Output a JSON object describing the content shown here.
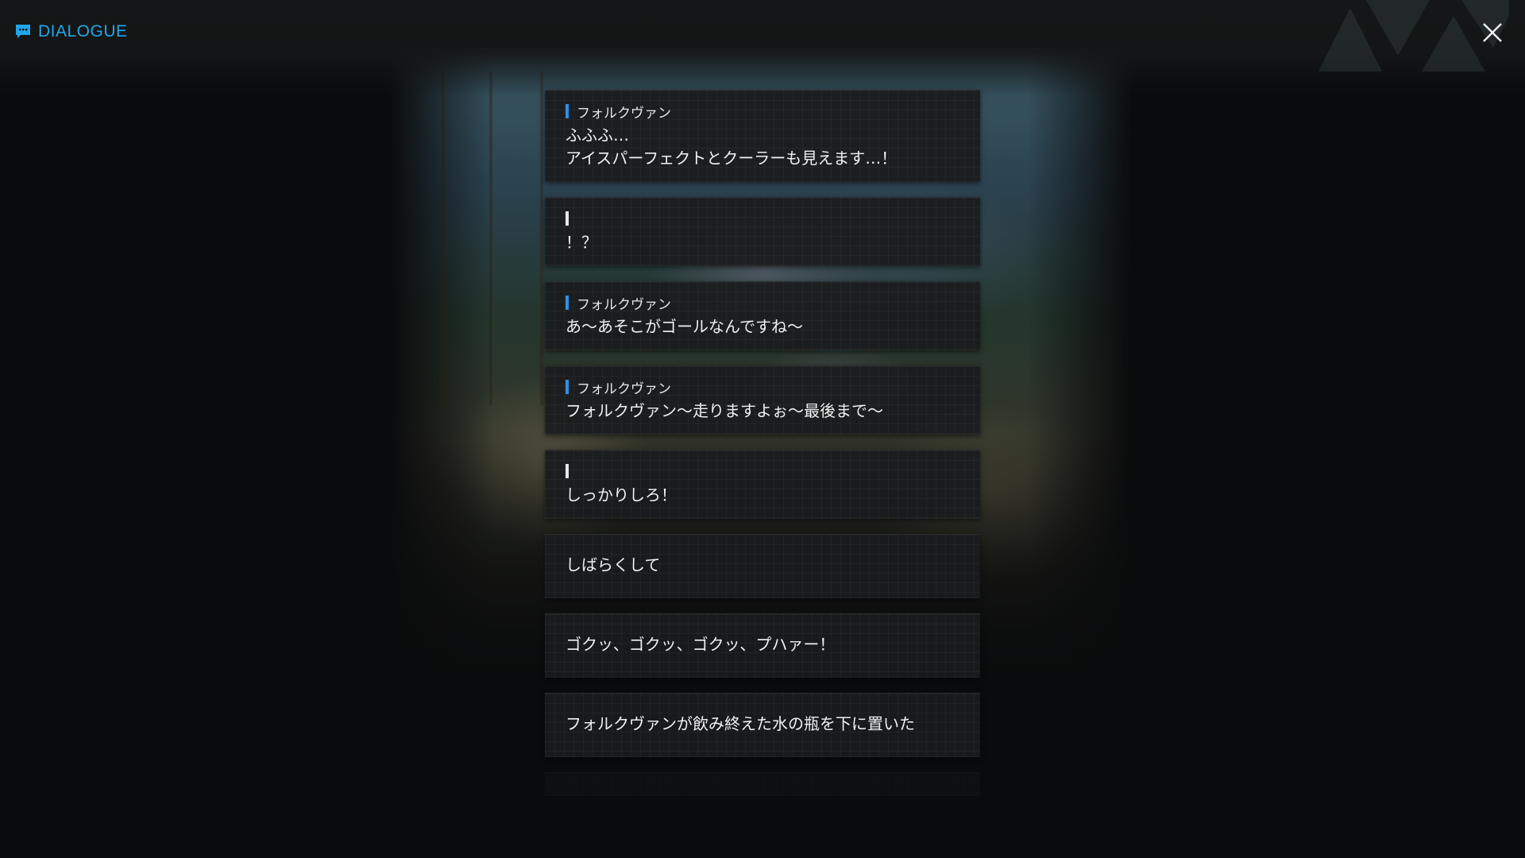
{
  "header": {
    "title": "DIALOGUE",
    "title_color": "#23a6e8",
    "icon": "chat-bubble-icon",
    "close_icon": "close-icon"
  },
  "dialogue": [
    {
      "speaker": "フォルクヴァン",
      "text": "ふふふ…\nアイスパーフェクトとクーラーも見えます…！"
    },
    {
      "speaker": "",
      "text": "！？"
    },
    {
      "speaker": "フォルクヴァン",
      "text": "あ～あそこがゴールなんですね～"
    },
    {
      "speaker": "フォルクヴァン",
      "text": "フォルクヴァン～走りますよぉ～最後まで～"
    },
    {
      "speaker": "",
      "text": "しっかりしろ！"
    },
    {
      "text": "しばらくして"
    },
    {
      "text": "ゴクッ、ゴクッ、ゴクッ、プハァー！"
    },
    {
      "text": "フォルクヴァンが飲み終えた水の瓶を下に置いた"
    }
  ],
  "colors": {
    "speaker_marker": "#2e8fe8",
    "player_marker": "#e8e8e8",
    "card_bg": "#1a1b1d"
  }
}
